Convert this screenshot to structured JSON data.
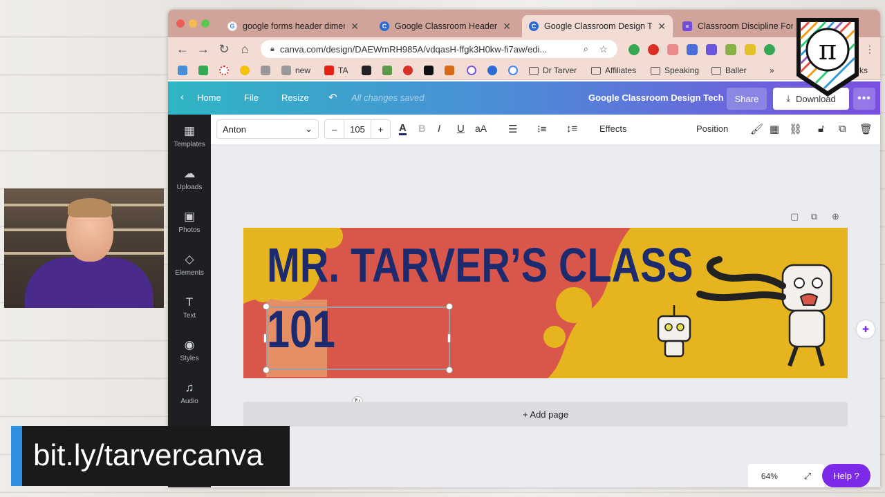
{
  "overlay": {
    "url_text": "bit.ly/tarvercanva"
  },
  "browser": {
    "tabs": [
      {
        "label": "google forms header dimens",
        "fav": "G",
        "color": "#4285f4"
      },
      {
        "label": "Google Classroom Header",
        "fav": "C",
        "color": "#2c6bd6"
      },
      {
        "label": "Google Classroom Design Te",
        "fav": "C",
        "color": "#2c6bd6"
      },
      {
        "label": "Classroom Discipline Form",
        "fav": "≡",
        "color": "#6e4bd8"
      }
    ],
    "url": "canva.com/design/DAEWmRH985A/vdqasH-ffgk3H0kw-fi7aw/edi...",
    "bookmarks": [
      "new",
      "TA",
      "Dr Tarver",
      "Affiliates",
      "Speaking",
      "Baller",
      "»",
      "rks"
    ]
  },
  "canva": {
    "home": "Home",
    "file": "File",
    "resize": "Resize",
    "saved_status": "All changes saved",
    "doc_title": "Google Classroom Design Tech",
    "share": "Share",
    "download": "Download",
    "more": "•••",
    "sidebar": [
      {
        "label": "Templates",
        "icon": "▦"
      },
      {
        "label": "Uploads",
        "icon": "☁"
      },
      {
        "label": "Photos",
        "icon": "▣"
      },
      {
        "label": "Elements",
        "icon": "◇"
      },
      {
        "label": "Text",
        "icon": "T"
      },
      {
        "label": "Styles",
        "icon": "◉"
      },
      {
        "label": "Audio",
        "icon": "♫"
      }
    ],
    "toolbar": {
      "font": "Anton",
      "size": "105",
      "minus": "–",
      "plus": "+",
      "effects": "Effects",
      "position": "Position"
    },
    "design": {
      "title": "MR. TARVER’S CLASS",
      "number": "101"
    },
    "add_page": "+ Add page",
    "zoom": "64%",
    "help": "Help ?",
    "colors": {
      "banner_yellow": "#e5b41e",
      "banner_red": "#d9574a",
      "title_navy": "#1d2a6e",
      "help_purple": "#7d2ae8"
    }
  }
}
